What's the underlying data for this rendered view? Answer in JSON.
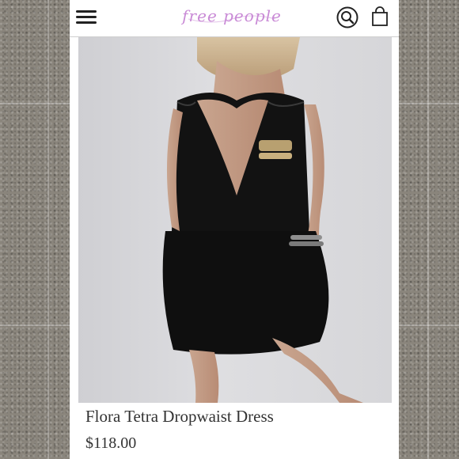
{
  "header": {
    "brand": "free people",
    "menu_icon": "hamburger-menu-icon",
    "search_icon": "search-icon",
    "cart_icon": "shopping-bag-icon",
    "brand_color": "#c98ad6"
  },
  "product": {
    "name": "Flora Tetra Dropwaist Dress",
    "price": "$118.00"
  },
  "colors": {
    "page_background": "#8a857c",
    "card_background": "#ffffff",
    "text": "#333333"
  }
}
